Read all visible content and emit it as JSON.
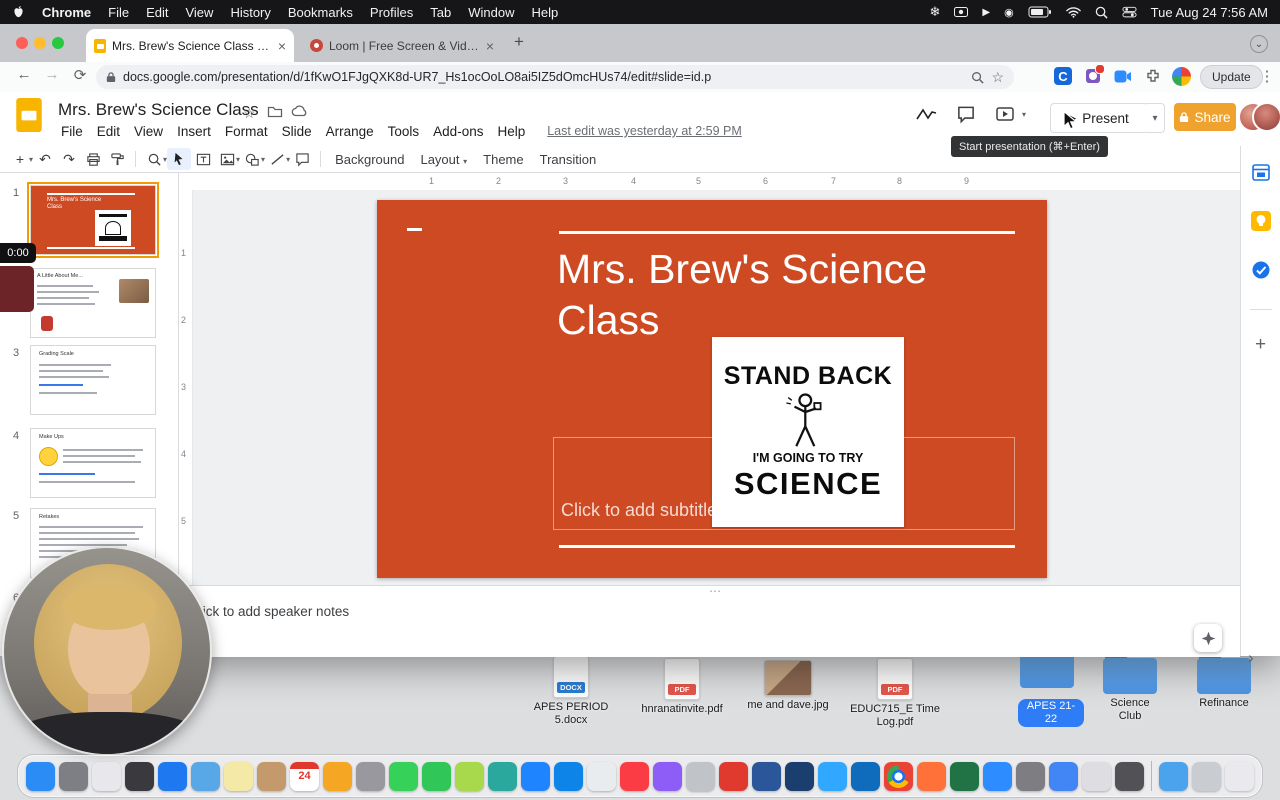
{
  "menubar": {
    "items": [
      "Chrome",
      "File",
      "Edit",
      "View",
      "History",
      "Bookmarks",
      "Profiles",
      "Tab",
      "Window",
      "Help"
    ],
    "clock": "Tue Aug 24 7:56 AM"
  },
  "icons": {
    "close": "×",
    "new_tab": "+",
    "back": "←",
    "forward": "→",
    "reload": "⟳",
    "overflow": "⋮",
    "dropdown": "▾",
    "play": "▶",
    "undo": "↶",
    "redo": "↷",
    "plus": "+",
    "star": "☆",
    "chevron_right": "›",
    "chevron_down": "⌄",
    "snowflake": "❄",
    "record": "◉",
    "menu_play": "▶",
    "dots_handle": "⋯",
    "collapse": "⌃"
  },
  "browser": {
    "tabs": [
      {
        "title": "Mrs. Brew's Science Class - G"
      },
      {
        "title": "Loom | Free Screen & Video Re"
      }
    ],
    "url": "docs.google.com/presentation/d/1fKwO1FJgQXK8d-UR7_Hs1ocOoLO8ai5IZ5dOmcHUs74/edit#slide=id.p",
    "update_label": "Update"
  },
  "app": {
    "doc_title": "Mrs. Brew's Science Class",
    "menus": [
      "File",
      "Edit",
      "View",
      "Insert",
      "Format",
      "Slide",
      "Arrange",
      "Tools",
      "Add-ons",
      "Help"
    ],
    "last_edit": "Last edit was yesterday at 2:59 PM",
    "present_label": "Present",
    "share_label": "Share",
    "tooltip": "Start presentation (⌘+Enter)",
    "toolbar": {
      "background": "Background",
      "layout": "Layout",
      "theme": "Theme",
      "transition": "Transition"
    }
  },
  "ruler_h": [
    "1",
    "2",
    "3",
    "4",
    "5",
    "6",
    "7",
    "8",
    "9"
  ],
  "ruler_v": [
    "1",
    "2",
    "3",
    "4",
    "5"
  ],
  "recorder": {
    "timer": "0:00"
  },
  "filmstrip": {
    "slides": [
      {
        "n": "1",
        "title": "Mrs. Brew's Science Class"
      },
      {
        "n": "2",
        "title": "A Little About Me..."
      },
      {
        "n": "3",
        "title": "Grading Scale"
      },
      {
        "n": "4",
        "title": "Make Ups"
      },
      {
        "n": "5",
        "title": "Retakes"
      },
      {
        "n": "6",
        "title": ""
      }
    ]
  },
  "slide": {
    "bg": "#CE4A23",
    "title_lines": [
      "Mrs. Brew's Science",
      "Class"
    ],
    "subtitle_placeholder": "Click to add subtitle",
    "image": {
      "line1": "STAND BACK",
      "line2": "I'M GOING TO TRY",
      "line3": "SCIENCE"
    }
  },
  "notes": {
    "placeholder": "Click to add speaker notes"
  },
  "desktop": {
    "files": [
      {
        "line1": "APES PERIOD",
        "line2": "5.docx",
        "kind": "DOCX"
      },
      {
        "line1": "hnranatinvite.pdf",
        "kind": "PDF"
      },
      {
        "line1": "me and dave.jpg"
      },
      {
        "line1": "EDUC715_E Time",
        "line2": "Log.pdf",
        "kind": "PDF"
      },
      {
        "line1": "APES 21-22"
      },
      {
        "line1": "Science Club"
      },
      {
        "line1": "Refinance"
      }
    ]
  },
  "dock": {
    "calendar_day": "24",
    "apps": [
      "#2A8CF4",
      "#7E7E85",
      "#E8E8EC",
      "#3A3A3E",
      "#1E78F0",
      "#58A8E8",
      "#F5E9A8",
      "#C49A6C",
      "#FFFFFF",
      "#F5A623",
      "#98989E",
      "#36D158",
      "#30C758",
      "#A8D84C",
      "#2AA89E",
      "#1E84FF",
      "#0D84E8",
      "#E8ECEF",
      "#FC3C44",
      "#8E5CF7",
      "#C0C4C8",
      "#E03A2E",
      "#2B579A",
      "#1A3E6E",
      "#31A8FF",
      "#0F6CBD",
      "#EA4335",
      "#FF7139",
      "#217346",
      "#2D8CFF",
      "#7D7D82",
      "#4285F4",
      "#DDDDE2",
      "#515156"
    ],
    "extras": [
      "#4AA3EC",
      "#C9CDD2",
      "#E9E9EE"
    ]
  }
}
